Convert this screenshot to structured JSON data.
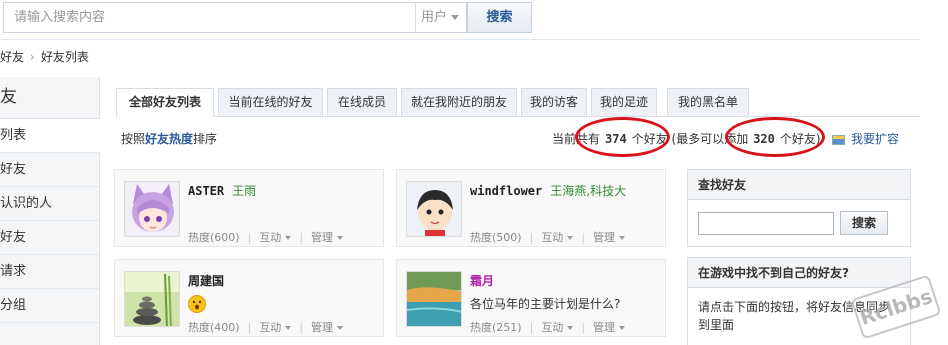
{
  "search": {
    "placeholder": "请输入搜索内容",
    "type_label": "用户",
    "button_label": "搜索"
  },
  "breadcrumb": [
    "好友",
    "好友列表"
  ],
  "sidebar": {
    "title": "友",
    "items": [
      "列表",
      "好友",
      "认识的人",
      "好友",
      "请求",
      "分组"
    ]
  },
  "tabs": [
    "全部好友列表",
    "当前在线的好友",
    "在线成员",
    "就在我附近的朋友",
    "我的访客",
    "我的足迹",
    "我的黑名单"
  ],
  "sort": {
    "prefix": "按照",
    "key": "好友热度",
    "suffix": "排序"
  },
  "stats": {
    "prefix": "当前共有",
    "count": "374",
    "mid": "个好友 (最多可以添加",
    "max": "320",
    "suffix": "个好友)"
  },
  "expand_label": "我要扩容",
  "friends": [
    {
      "name": "ASTER",
      "note": "王雨",
      "status": "",
      "heat": "热度(600)",
      "interact": "互动",
      "manage": "管理",
      "avatar": "anime-cat-girl"
    },
    {
      "name": "windflower",
      "note": "王海燕,科技大",
      "status": "",
      "heat": "热度(500)",
      "interact": "互动",
      "manage": "管理",
      "avatar": "cartoon-boy"
    },
    {
      "name": "周建国",
      "note": "",
      "status": "😮",
      "heat": "热度(400)",
      "interact": "互动",
      "manage": "管理",
      "avatar": "zen-stones"
    },
    {
      "name": "霜月",
      "note": "",
      "status": "各位马年的主要计划是什么?",
      "heat": "热度(251)",
      "interact": "互动",
      "manage": "管理",
      "avatar": "lake-landscape"
    }
  ],
  "find_panel": {
    "title": "查找好友",
    "button": "搜索"
  },
  "game_panel": {
    "title": "在游戏中找不到自己的好友?",
    "text": "请点击下面的按钮，将好友信息同步到里面"
  },
  "watermark": "Rclbbs",
  "colors": {
    "accent": "#2a5b9a",
    "note_green": "#2f8a2f",
    "highlight_red": "#d8141a"
  }
}
